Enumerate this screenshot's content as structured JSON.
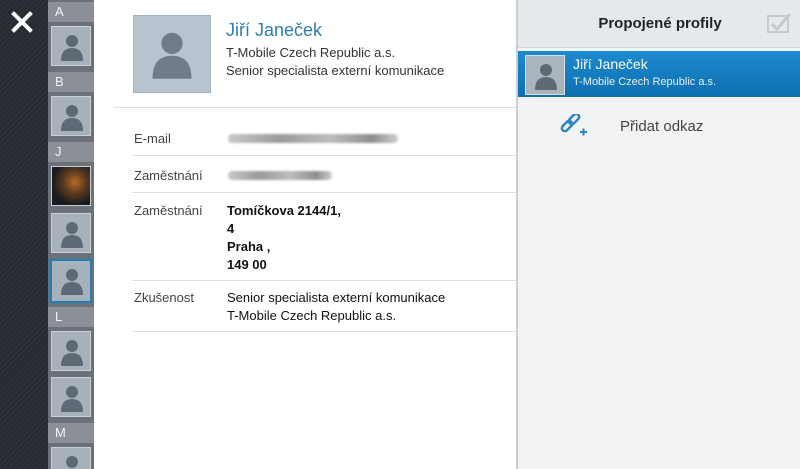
{
  "close_icon": "close-icon",
  "alphabet": [
    {
      "letter": "A"
    },
    {
      "letter": "B"
    },
    {
      "letter": "J"
    },
    {
      "letter": "L"
    },
    {
      "letter": "M"
    }
  ],
  "contact": {
    "name": "Jiří Janeček",
    "company": "T-Mobile Czech Republic a.s.",
    "role": "Senior specialista externí komunikace"
  },
  "fields": {
    "email_label": "E-mail",
    "phone_label": "Zaměstnání",
    "address_label": "Zaměstnání",
    "address_lines": [
      "Tomíčkova 2144/1,",
      "4",
      "Praha ,",
      "149 00"
    ],
    "experience_label": "Zkušenost",
    "experience_lines": [
      "Senior specialista externí komunikace",
      "T-Mobile Czech Republic a.s."
    ]
  },
  "linked_profiles": {
    "title": "Propojené profily",
    "items": [
      {
        "name": "Jiří Janeček",
        "company": "T-Mobile Czech Republic a.s."
      }
    ],
    "add_label": "Přidat odkaz"
  },
  "colors": {
    "accent": "#1e8ad0",
    "name_blue": "#2f7db0"
  }
}
